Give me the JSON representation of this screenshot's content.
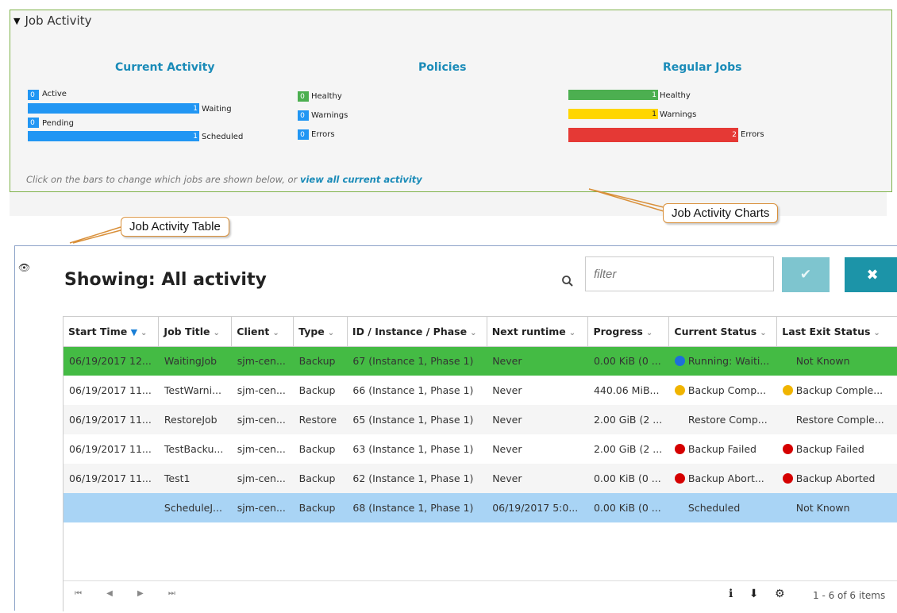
{
  "job_activity": {
    "title": "Job Activity",
    "current_activity": {
      "heading": "Current Activity",
      "bars": [
        {
          "name": "Active",
          "count": "0",
          "color": "#2196f3"
        },
        {
          "name": "Waiting",
          "count": "1",
          "color": "#2196f3"
        },
        {
          "name": "Pending",
          "count": "0",
          "color": "#2196f3"
        },
        {
          "name": "Scheduled",
          "count": "1",
          "color": "#2196f3"
        }
      ]
    },
    "policies": {
      "heading": "Policies",
      "bars": [
        {
          "name": "Healthy",
          "count": "0",
          "color": "#4caf50"
        },
        {
          "name": "Warnings",
          "count": "0",
          "color": "#2196f3"
        },
        {
          "name": "Errors",
          "count": "0",
          "color": "#2196f3"
        }
      ]
    },
    "regular_jobs": {
      "heading": "Regular Jobs",
      "bars": [
        {
          "name": "Healthy",
          "count": "1",
          "color": "#4caf50"
        },
        {
          "name": "Warnings",
          "count": "1",
          "color": "#ffd600"
        },
        {
          "name": "Errors",
          "count": "2",
          "color": "#e53935"
        }
      ]
    },
    "hint_text": "Click on the bars to change which jobs are shown below, or ",
    "hint_link": "view all current activity"
  },
  "callouts": {
    "charts": "Job Activity Charts",
    "table": "Job Activity Table"
  },
  "table_panel": {
    "showing": "Showing: All activity",
    "filter_placeholder": "filter",
    "ok_symbol": "✔",
    "close_symbol": "✖",
    "columns": [
      "Start Time",
      "Job Title",
      "Client",
      "Type",
      "ID / Instance / Phase",
      "Next runtime",
      "Progress",
      "Current Status",
      "Last Exit Status"
    ],
    "rows": [
      {
        "bg": "#44bb44",
        "cells": [
          "06/19/2017 12...",
          "WaitingJob",
          "sjm-cen...",
          "Backup",
          "67 (Instance 1, Phase 1)",
          "Never",
          "0.00 KiB (0 ...",
          "Running: Waiti...",
          "Not Known"
        ],
        "status_dot": "#1e6fd9",
        "exit_dot": ""
      },
      {
        "bg": "#ffffff",
        "cells": [
          "06/19/2017 11...",
          "TestWarni...",
          "sjm-cen...",
          "Backup",
          "66 (Instance 1, Phase 1)",
          "Never",
          "440.06 MiB...",
          "Backup Comp...",
          "Backup Comple..."
        ],
        "status_dot": "#f0b400",
        "exit_dot": "#f0b400"
      },
      {
        "bg": "#f5f5f5",
        "cells": [
          "06/19/2017 11...",
          "RestoreJob",
          "sjm-cen...",
          "Restore",
          "65 (Instance 1, Phase 1)",
          "Never",
          "2.00 GiB (2 ...",
          "Restore Comp...",
          "Restore Comple..."
        ],
        "status_dot": "",
        "exit_dot": ""
      },
      {
        "bg": "#ffffff",
        "cells": [
          "06/19/2017 11...",
          "TestBacku...",
          "sjm-cen...",
          "Backup",
          "63 (Instance 1, Phase 1)",
          "Never",
          "2.00 GiB (2 ...",
          "Backup Failed",
          "Backup Failed"
        ],
        "status_dot": "#d50000",
        "exit_dot": "#d50000"
      },
      {
        "bg": "#f5f5f5",
        "cells": [
          "06/19/2017 11...",
          "Test1",
          "sjm-cen...",
          "Backup",
          "62 (Instance 1, Phase 1)",
          "Never",
          "0.00 KiB (0 ...",
          "Backup Abort...",
          "Backup Aborted"
        ],
        "status_dot": "#d50000",
        "exit_dot": "#d50000"
      },
      {
        "bg": "#a9d4f5",
        "cells": [
          "",
          "ScheduleJ...",
          "sjm-cen...",
          "Backup",
          "68 (Instance 1, Phase 1)",
          "06/19/2017 5:0...",
          "0.00 KiB (0 ...",
          "Scheduled",
          "Not Known"
        ],
        "status_dot": "",
        "exit_dot": ""
      }
    ],
    "pager_symbols": "⏮ ◀ ▶ ⏭",
    "tool_symbols": "ℹ ⬇ ⚙",
    "items_text": "1 - 6 of 6 items"
  }
}
